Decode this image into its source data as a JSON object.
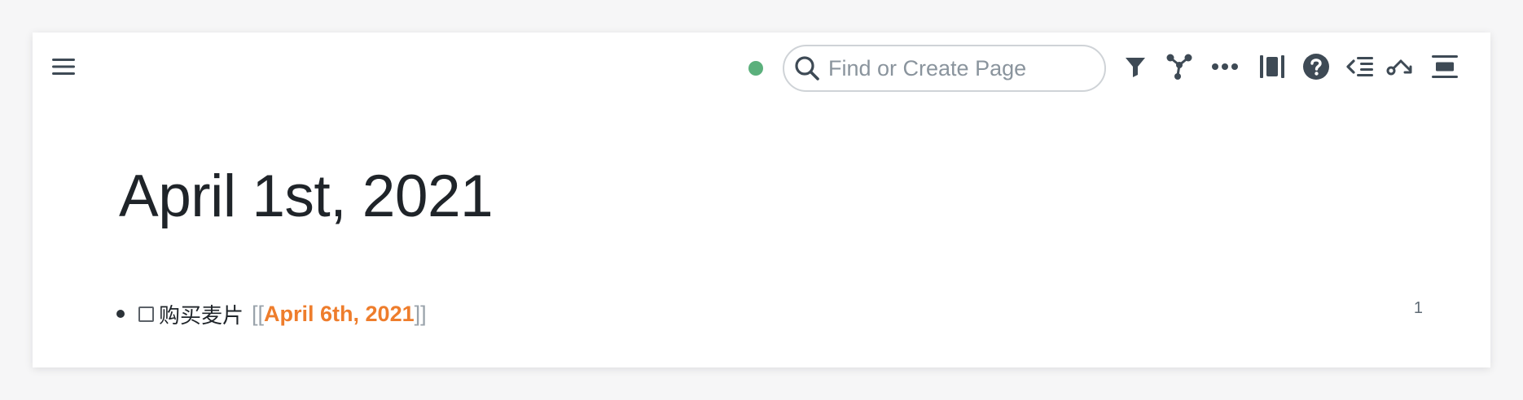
{
  "topbar": {
    "menu_icon": "hamburger-menu-icon",
    "sync_status_color": "#5bb07c",
    "search": {
      "placeholder": "Find or Create Page",
      "value": ""
    },
    "toolbar_icons": [
      "filter-icon",
      "graph-icon",
      "more-icon",
      "sidebar-toggle-icon",
      "help-icon",
      "outdent-icon",
      "diagram-icon",
      "align-icon"
    ]
  },
  "page": {
    "title": "April 1st, 2021",
    "blocks": [
      {
        "checked": false,
        "text": "购买麦片",
        "ref_open": "[[",
        "ref": "April 6th, 2021",
        "ref_close": "]]",
        "ref_count": "1"
      }
    ]
  },
  "colors": {
    "accent": "#ee7d2c",
    "text": "#1f2429",
    "icon": "#3e4a55"
  }
}
